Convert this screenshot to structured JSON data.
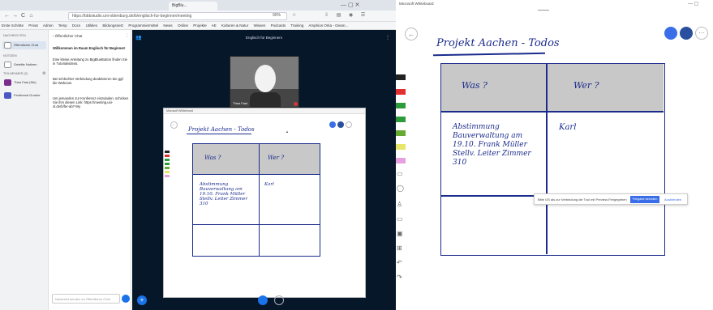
{
  "browser": {
    "tabs": [
      {
        "label": "BigBlu..."
      },
      {
        "label": "Microsoft Whiteboard"
      }
    ],
    "nav": {
      "back": "←",
      "forward": "→",
      "reload": "C",
      "home": "⌂"
    },
    "url": "https://bbbstudio.uni-oldenburg.de/b/englisch-fur-beginner/meeting",
    "zoom": "90%",
    "bookmarks": [
      "Erste Schritte",
      "Privat",
      "Admin",
      "Temp",
      "Docs",
      "Utilities",
      "Bildungsnetz",
      "Programmiermittel",
      "News",
      "Online",
      "Projekte",
      "AE",
      "Kulturen & Natur",
      "Wissen",
      "Podcasts",
      "Training",
      "Amphion Orka - Geam..."
    ]
  },
  "sidebar": {
    "messages_header": "Nachrichten",
    "public_chat": "Öffentlicher Chat",
    "notes_header": "Notizen",
    "shared_notes": "Geteilte Notizen",
    "users_header": "Teilnehmer (2)",
    "users": [
      {
        "name": "Thea Fast (Sie)",
        "color": "#7b2d8e"
      },
      {
        "name": "Ferdinand Groehe",
        "color": "#4b57c5"
      }
    ]
  },
  "chat": {
    "title": "Öffentlicher Chat",
    "welcome": "Willkommen im Raum Englisch für Beginner!",
    "tutorial": "Eine kleine Anleitung zu BigBlueButton finden Sie in Tutorialvideos.",
    "audio_info": "Bei schlechter Verbindung deaktivieren Sie ggf. die Webcam.",
    "invite_info": "Um jemanden zur Konferenz einzuladen, schicken Sie ihm diesen Link: https://meeting.uni-ol.de/b/fer-ab7-9ry",
    "input_placeholder": "Nachricht senden an Öffentlicher Chat"
  },
  "meeting": {
    "room_title": "Englisch für Beginners",
    "webcam_name": "Thea Fast"
  },
  "whiteboard": {
    "app_title": "Microsoft Whiteboard",
    "board_title": "Projekt Aachen - Todos",
    "table": {
      "headers": [
        "Was ?",
        "Wer ?"
      ],
      "rows": [
        {
          "was": "Abstimmung Bauverwaltung am 19.10. Frank Müller Stellv. Leiter Zimmer 310",
          "wer": "Karl"
        },
        {
          "was": "",
          "wer": ""
        }
      ]
    },
    "toast_text": "Bitte OS als zur Verbindung die Tool mit Preview-Freigegeben",
    "toast_button": "Freigabe beenden",
    "toast_link": "Ausblenden",
    "colors": {
      "header_fill": "#c8c8c8",
      "ink": "#1a2b8c",
      "accent": "#3a6ee8"
    }
  }
}
